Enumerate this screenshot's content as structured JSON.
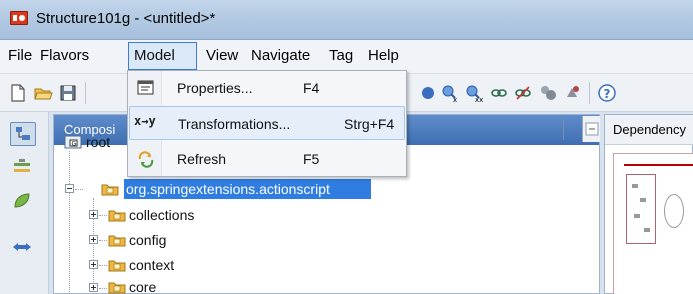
{
  "window": {
    "title": "Structure101g - <untitled>*"
  },
  "menubar": {
    "items": [
      "File",
      "Flavors",
      "Model",
      "View",
      "Navigate",
      "Tag",
      "Help"
    ]
  },
  "model_menu": {
    "items": [
      {
        "label": "Properties...",
        "shortcut": "F4",
        "icon": "properties-icon"
      },
      {
        "label": "Transformations...",
        "shortcut": "Strg+F4",
        "icon": "transformations-icon",
        "icon_text": "x→y"
      },
      {
        "label": "Refresh",
        "shortcut": "F5",
        "icon": "refresh-icon"
      }
    ]
  },
  "composition_panel": {
    "title": "Composi"
  },
  "dependency_panel": {
    "title": "Dependency"
  },
  "tree": {
    "root": "root",
    "selected": "org.springextensions.actionscript",
    "children": [
      "collections",
      "config",
      "context",
      "core"
    ]
  },
  "colors": {
    "selection": "#2f7de1",
    "panel_header": "#4a7bbf",
    "folder": "#f0b840"
  }
}
